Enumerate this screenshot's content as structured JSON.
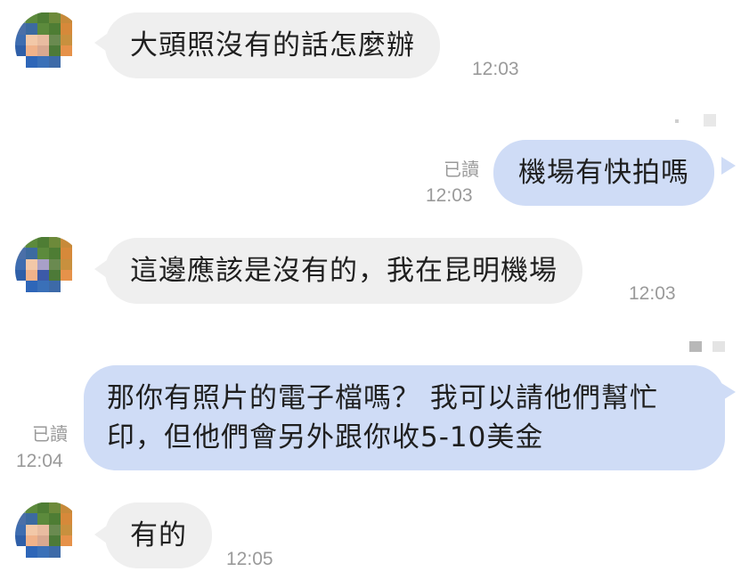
{
  "messages": [
    {
      "direction": "in",
      "text": "大頭照沒有的話怎麼辦",
      "time": "12:03"
    },
    {
      "direction": "out",
      "text": "機場有快拍嗎",
      "time": "12:03",
      "read": "已讀"
    },
    {
      "direction": "in",
      "text": "這邊應該是沒有的，我在昆明機場",
      "time": "12:03"
    },
    {
      "direction": "out",
      "text_line1": "那你有照片的電子檔嗎？ 我可以請他們幫忙",
      "text_line2": "印，但他們會另外跟你收5-10美金",
      "time": "12:04",
      "read": "已讀"
    },
    {
      "direction": "in",
      "text": "有的",
      "time": "12:05"
    }
  ],
  "colors": {
    "incoming_bubble": "#efefef",
    "outgoing_bubble": "#cfdcf6",
    "timestamp": "#9a9a9a"
  },
  "avatar": {
    "description_icon": "pixelated-avatar-icon"
  }
}
